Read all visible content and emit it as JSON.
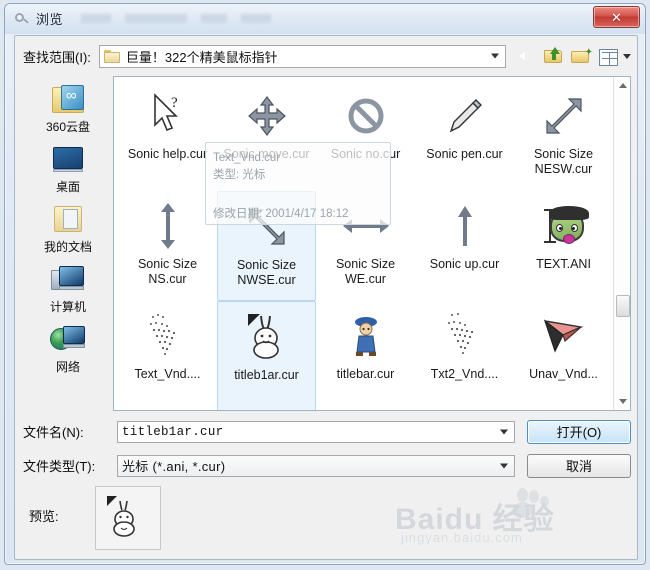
{
  "window": {
    "title": "浏览",
    "title_icon": "magnifier-icon",
    "close_label": "✕"
  },
  "lookin": {
    "label": "查找范围(I):",
    "path": "巨量！322个精美鼠标指针",
    "folder_icon": "folder-icon",
    "dropdown_icon": "chevron-down-icon"
  },
  "toolbar": {
    "back": "back-icon",
    "up": "up-folder-icon",
    "new_folder": "new-folder-icon",
    "views": "views-icon",
    "views_arrow": "chevron-down-icon"
  },
  "places": [
    {
      "label": "360云盘",
      "icon": "cloud-drive-icon"
    },
    {
      "label": "桌面",
      "icon": "desktop-icon"
    },
    {
      "label": "我的文档",
      "icon": "my-documents-icon"
    },
    {
      "label": "计算机",
      "icon": "computer-icon"
    },
    {
      "label": "网络",
      "icon": "network-icon"
    }
  ],
  "files": {
    "rows": [
      [
        {
          "name": "Sonic help.cur",
          "icon": "cursor-help-icon",
          "selected": false
        },
        {
          "name": "Sonic move.cur",
          "icon": "cursor-move-icon",
          "selected": false
        },
        {
          "name": "Sonic no.cur",
          "icon": "cursor-no-icon",
          "selected": false
        },
        {
          "name": "Sonic pen.cur",
          "icon": "cursor-pen-icon",
          "selected": false
        },
        {
          "name": "Sonic Size NESW.cur",
          "icon": "cursor-size-nesw-icon",
          "selected": false
        }
      ],
      [
        {
          "name": "Sonic Size NS.cur",
          "icon": "cursor-size-ns-icon",
          "selected": false
        },
        {
          "name": "Sonic Size NWSE.cur",
          "icon": "cursor-size-nwse-icon",
          "selected": true
        },
        {
          "name": "Sonic Size WE.cur",
          "icon": "cursor-size-we-icon",
          "selected": false
        },
        {
          "name": "Sonic up.cur",
          "icon": "cursor-up-icon",
          "selected": false
        },
        {
          "name": "TEXT.ANI",
          "icon": "cursor-text-ani-icon",
          "selected": false
        }
      ],
      [
        {
          "name": "Text_Vnd....",
          "icon": "cursor-text-vnd-icon",
          "selected": false
        },
        {
          "name": "titleb1ar.cur",
          "icon": "cursor-bunny-icon",
          "selected": true
        },
        {
          "name": "titlebar.cur",
          "icon": "cursor-boy-icon",
          "selected": false
        },
        {
          "name": "Txt2_Vnd....",
          "icon": "cursor-txt2-vnd-icon",
          "selected": false
        },
        {
          "name": "Unav_Vnd...",
          "icon": "cursor-unav-vnd-icon",
          "selected": false
        }
      ],
      [
        {
          "name": "",
          "icon": "cursor-torch-icon",
          "selected": false
        },
        {
          "name": "",
          "icon": "cursor-pen2-icon",
          "selected": false
        },
        {
          "name": "",
          "icon": "cursor-bunny-arrows-icon",
          "selected": false
        },
        {
          "name": "",
          "icon": "cursor-bunny-arrows2-icon",
          "selected": false
        },
        {
          "name": "",
          "icon": "cursor-rock-icon",
          "selected": false
        }
      ]
    ]
  },
  "tooltip": {
    "line1": "Text_Vnd.cur",
    "line2": "类型: 光标",
    "line3": "修改日期: 2001/4/17 18:12"
  },
  "form": {
    "filename_label": "文件名(N):",
    "filename_value": "titleb1ar.cur",
    "filetype_label": "文件类型(T):",
    "filetype_value": "光标 (*.ani, *.cur)",
    "open_button": "打开(O)",
    "cancel_button": "取消",
    "dropdown_icon": "chevron-down-icon"
  },
  "preview": {
    "label": "预览:",
    "icon": "cursor-bunny-preview-icon"
  },
  "watermark": {
    "main": "Baidu 经验",
    "sub": "jingyan.baidu.com"
  },
  "scrollbar": {
    "up_icon": "scroll-up-icon",
    "down_icon": "scroll-down-icon",
    "thumb": "scroll-thumb"
  },
  "colors": {
    "accent": "#4a90c4",
    "selection": "#eaf4fd",
    "close": "#c03a32",
    "titlebar": "#dde8f4"
  }
}
